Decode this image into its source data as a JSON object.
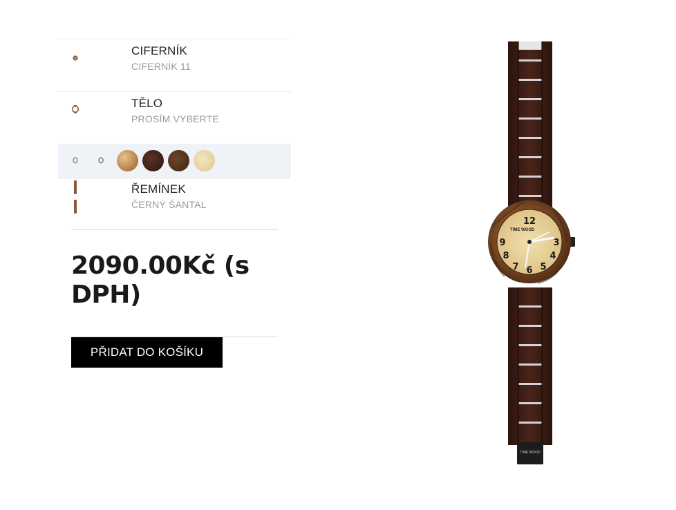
{
  "config": {
    "dial": {
      "title": "CIFERNÍK",
      "value": "CIFERNÍK 11"
    },
    "body": {
      "title": "TĚLO",
      "value": "PROSÍM VYBERTE"
    },
    "body_swatches": [
      {
        "name": "zebrano-light",
        "color": "#c79a60"
      },
      {
        "name": "dark-sandal",
        "color": "#4a2a20"
      },
      {
        "name": "walnut",
        "color": "#5e3a22"
      },
      {
        "name": "maple",
        "color": "#ead9a8"
      }
    ],
    "strap": {
      "title": "ŘEMÍNEK",
      "value": "ČERNÝ ŠANTAL"
    }
  },
  "price": "2090.00Kč (s DPH)",
  "cart_button": "PŘIDAT DO KOŠÍKU",
  "watch": {
    "brand": "TIME WOOD",
    "dial_numbers": [
      "12",
      "3",
      "4",
      "5",
      "6",
      "7",
      "8",
      "9"
    ]
  }
}
